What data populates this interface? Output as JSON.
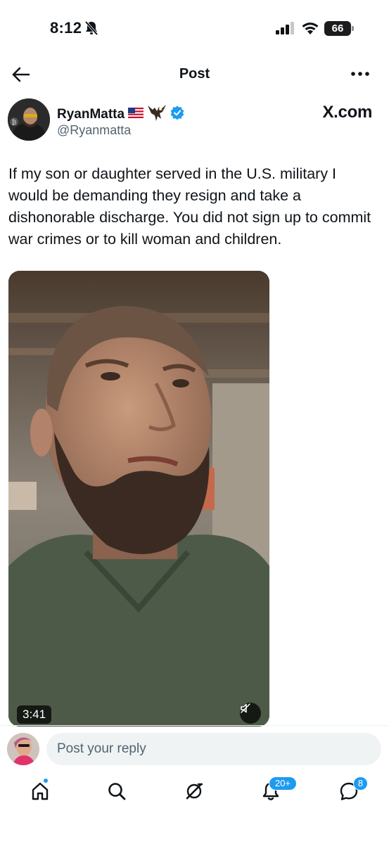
{
  "status_bar": {
    "time": "8:12",
    "battery": "66"
  },
  "header": {
    "title": "Post"
  },
  "author": {
    "name": "RyanMatta",
    "handle": "@Ryanmatta",
    "verified": true
  },
  "source_label": "X.com",
  "post": {
    "text": "If my son or daughter served in the U.S. military I would be demanding they resign and take a dishonorable discharge. You did not sign up to commit war crimes or to kill woman and children."
  },
  "video": {
    "duration": "3:41",
    "muted": true
  },
  "reply": {
    "placeholder": "Post your reply"
  },
  "tab_bar": {
    "notifications_badge": "20+",
    "messages_badge": "8"
  },
  "colors": {
    "accent": "#1d9bf0",
    "text": "#0f1419",
    "secondary_text": "#536471",
    "input_bg": "#eff3f4"
  }
}
